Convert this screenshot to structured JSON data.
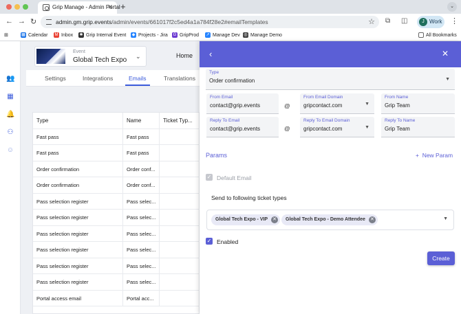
{
  "browser": {
    "tab_title": "Grip Manage - Admin Portal",
    "url_host": "admin.gm.grip.events",
    "url_path": "/admin/events/661017f2c5ed4a1a784f28e2#emailTemplates",
    "profile_label": "Work",
    "profile_initial": "J",
    "bookmarks": [
      {
        "label": "Calendar",
        "icon": "calendar-icon",
        "color": "#1a73e8"
      },
      {
        "label": "Inbox",
        "icon": "gmail-icon",
        "color": "#ea4335"
      },
      {
        "label": "Grip Internal Event",
        "icon": "grip-icon",
        "color": "#333333"
      },
      {
        "label": "Projects - Jira",
        "icon": "jira-icon",
        "color": "#2684ff"
      },
      {
        "label": "GripProd",
        "icon": "grip-prod-icon",
        "color": "#6c3bd1"
      },
      {
        "label": "Manage Dev",
        "icon": "manage-dev-icon",
        "color": "#2684ff"
      },
      {
        "label": "Manage Demo",
        "icon": "manage-demo-icon",
        "color": "#444444"
      }
    ],
    "all_bookmarks_label": "All Bookmarks"
  },
  "header": {
    "event_label": "Event",
    "event_name": "Global Tech Expo",
    "home_label": "Home"
  },
  "tabs": [
    {
      "label": "Settings"
    },
    {
      "label": "Integrations"
    },
    {
      "label": "Emails",
      "active": true
    },
    {
      "label": "Translations"
    }
  ],
  "table": {
    "columns": [
      "Type",
      "Name",
      "Ticket Typ..."
    ],
    "rows": [
      [
        "Fast pass",
        "Fast pass",
        ""
      ],
      [
        "Fast pass",
        "Fast pass",
        ""
      ],
      [
        "Order confirmation",
        "Order conf...",
        ""
      ],
      [
        "Order confirmation",
        "Order conf...",
        ""
      ],
      [
        "Pass selection register",
        "Pass selec...",
        ""
      ],
      [
        "Pass selection register",
        "Pass selec...",
        ""
      ],
      [
        "Pass selection register",
        "Pass selec...",
        ""
      ],
      [
        "Pass selection register",
        "Pass selec...",
        ""
      ],
      [
        "Pass selection register",
        "Pass selec...",
        ""
      ],
      [
        "Pass selection register",
        "Pass selec...",
        ""
      ],
      [
        "Portal access email",
        "Portal acc...",
        ""
      ]
    ]
  },
  "drawer": {
    "type_label": "Type",
    "type_value": "Order confirmation",
    "from_email_label": "From Email",
    "from_email_value": "contact@grip.events",
    "from_domain_label": "From Email Domain",
    "from_domain_value": "gripcontact.com",
    "from_name_label": "From Name",
    "from_name_value": "Grip Team",
    "reply_email_label": "Reply To Email",
    "reply_email_value": "contact@grip.events",
    "reply_domain_label": "Reply To Email Domain",
    "reply_domain_value": "gripcontact.com",
    "reply_name_label": "Reply To Name",
    "reply_name_value": "Grip Team",
    "at_symbol": "@",
    "params_title": "Params",
    "new_param_label": "New Param",
    "default_email_label": "Default Email",
    "default_email_checked": true,
    "send_to_label": "Send to following ticket types",
    "ticket_chips": [
      "Global Tech Expo - VIP",
      "Global Tech Expo - Demo Attendee"
    ],
    "enabled_label": "Enabled",
    "enabled_checked": true,
    "create_label": "Create"
  },
  "colors": {
    "accent": "#5b5fd6",
    "rail_icon": "#3b5bdb"
  }
}
